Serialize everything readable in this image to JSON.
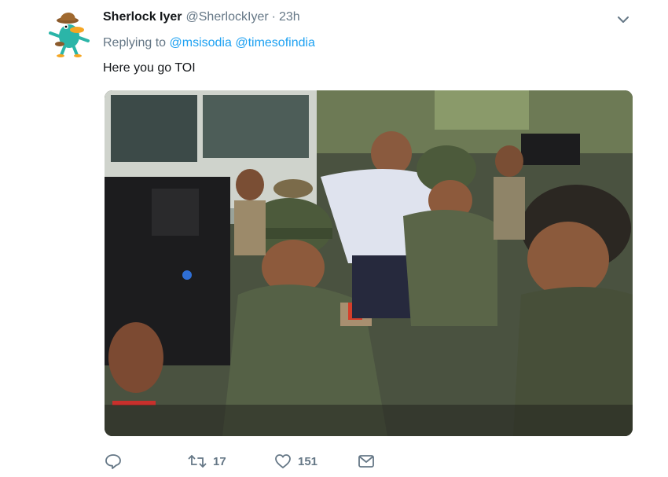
{
  "tweet": {
    "display_name": "Sherlock Iyer",
    "handle": "@SherlockIyer",
    "separator": "·",
    "time": "23h",
    "reply_prefix": "Replying to",
    "reply_mentions": [
      "@msisodia",
      "@timesofindia"
    ],
    "text": "Here you go TOI",
    "avatar_icon": "platypus-detective-avatar",
    "menu_icon": "chevron-down-icon"
  },
  "actions": {
    "reply_count": "",
    "retweet_count": "17",
    "like_count": "151",
    "icons": [
      "reply-icon",
      "retweet-icon",
      "heart-icon",
      "direct-message-icon"
    ]
  },
  "colors": {
    "link": "#1da1f2",
    "secondary_text": "#657786",
    "primary_text": "#14171a"
  }
}
